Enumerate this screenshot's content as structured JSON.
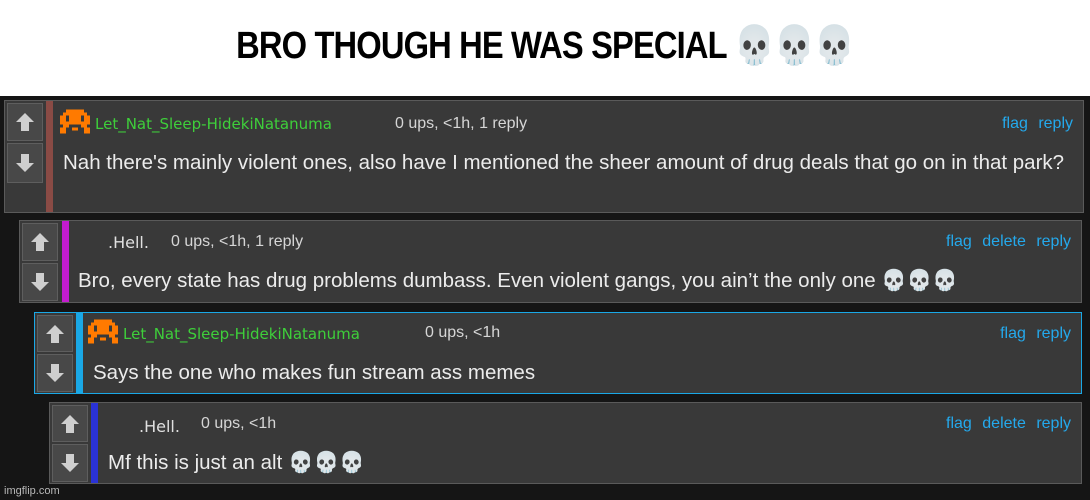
{
  "caption": "BRO THOUGH HE WAS SPECIAL 💀💀💀",
  "comments": [
    {
      "user": "Let_Nat_Sleep-HidekiNatanuma",
      "meta": "0 ups, <1h, 1 reply",
      "actions": [
        "flag",
        "reply"
      ],
      "text": "Nah there's mainly violent ones, also have I mentioned the sheer amount of drug deals that go on in that park?",
      "bar_color": "#8a4b45"
    },
    {
      "user": ".Hell.",
      "meta": "0 ups, <1h, 1 reply",
      "actions": [
        "flag",
        "delete",
        "reply"
      ],
      "text": "Bro, every state has drug problems dumbass. Even violent gangs, you ain’t the only one 💀💀💀",
      "bar_color": "#c41ccf"
    },
    {
      "user": "Let_Nat_Sleep-HidekiNatanuma",
      "meta": "0 ups, <1h",
      "actions": [
        "flag",
        "reply"
      ],
      "text": "Says the one who makes fun stream ass memes",
      "bar_color": "#1aa8e6"
    },
    {
      "user": ".Hell.",
      "meta": "0 ups, <1h",
      "actions": [
        "flag",
        "delete",
        "reply"
      ],
      "text": "Mf this is just an alt 💀💀💀",
      "bar_color": "#2a32d6"
    }
  ],
  "icons": {
    "upvote": "arrow-up-icon",
    "downvote": "arrow-down-icon",
    "avatar": "pixel-invader-icon"
  },
  "colors": {
    "username_green": "#3ecf3a",
    "action_blue": "#24a9ec",
    "avatar_orange": "#ff7a00"
  },
  "watermark": "imgflip.com"
}
